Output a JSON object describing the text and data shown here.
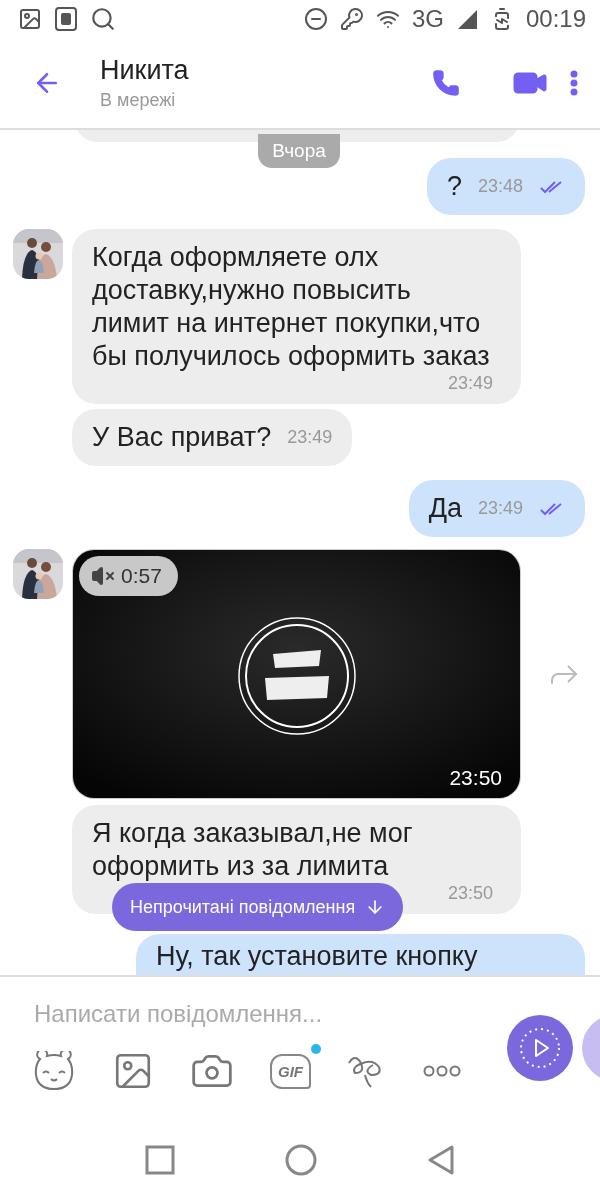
{
  "status_bar": {
    "network": "3G",
    "time": "00:19"
  },
  "header": {
    "name": "Никита",
    "status": "В мережі"
  },
  "messages": [
    {
      "kind": "date",
      "text": "Вчора"
    },
    {
      "kind": "outgoing",
      "text": "?",
      "time": "23:48",
      "read": true
    },
    {
      "kind": "incoming",
      "avatar": true,
      "text": "Когда оформляете олх доставку,нужно повысить лимит на интернет покупки,что бы получилось оформить заказ",
      "time": "23:49"
    },
    {
      "kind": "incoming",
      "avatar": false,
      "text": "У Вас приват?",
      "time": "23:49"
    },
    {
      "kind": "outgoing",
      "text": "Да",
      "time": "23:49",
      "read": true
    },
    {
      "kind": "video",
      "avatar": true,
      "muted": true,
      "duration": "0:57",
      "time": "23:50"
    },
    {
      "kind": "incoming",
      "avatar": false,
      "text": "Я когда заказывал,не мог оформить из за лимита",
      "time": "23:50"
    },
    {
      "kind": "outgoing_cut",
      "text": "Ну, так установите кнопку"
    }
  ],
  "unread_banner": "Непрочитані повідомлення",
  "composer": {
    "placeholder": "Написати повідомлення...",
    "tools": [
      {
        "kind": "sticker"
      },
      {
        "kind": "gallery"
      },
      {
        "kind": "camera"
      },
      {
        "kind": "gif",
        "label": "GIF",
        "new": true
      },
      {
        "kind": "doodle"
      },
      {
        "kind": "more"
      }
    ]
  }
}
